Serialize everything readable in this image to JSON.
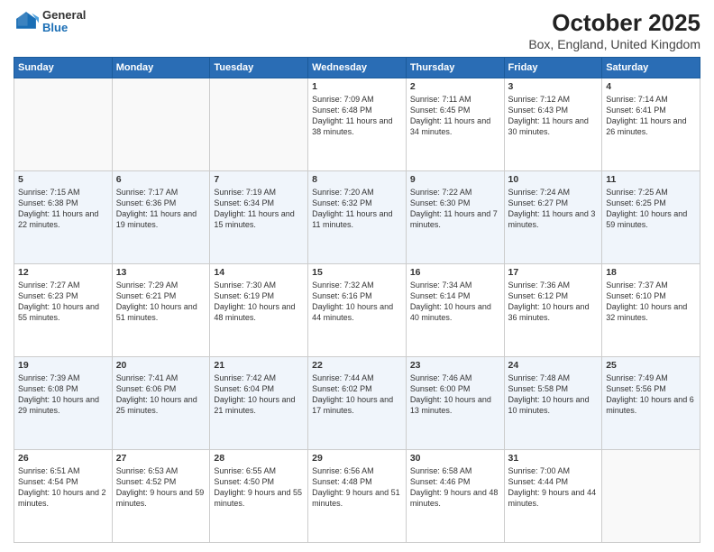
{
  "header": {
    "logo_general": "General",
    "logo_blue": "Blue",
    "title": "October 2025",
    "subtitle": "Box, England, United Kingdom"
  },
  "days_of_week": [
    "Sunday",
    "Monday",
    "Tuesday",
    "Wednesday",
    "Thursday",
    "Friday",
    "Saturday"
  ],
  "weeks": [
    [
      {
        "day": "",
        "info": ""
      },
      {
        "day": "",
        "info": ""
      },
      {
        "day": "",
        "info": ""
      },
      {
        "day": "1",
        "info": "Sunrise: 7:09 AM\nSunset: 6:48 PM\nDaylight: 11 hours\nand 38 minutes."
      },
      {
        "day": "2",
        "info": "Sunrise: 7:11 AM\nSunset: 6:45 PM\nDaylight: 11 hours\nand 34 minutes."
      },
      {
        "day": "3",
        "info": "Sunrise: 7:12 AM\nSunset: 6:43 PM\nDaylight: 11 hours\nand 30 minutes."
      },
      {
        "day": "4",
        "info": "Sunrise: 7:14 AM\nSunset: 6:41 PM\nDaylight: 11 hours\nand 26 minutes."
      }
    ],
    [
      {
        "day": "5",
        "info": "Sunrise: 7:15 AM\nSunset: 6:38 PM\nDaylight: 11 hours\nand 22 minutes."
      },
      {
        "day": "6",
        "info": "Sunrise: 7:17 AM\nSunset: 6:36 PM\nDaylight: 11 hours\nand 19 minutes."
      },
      {
        "day": "7",
        "info": "Sunrise: 7:19 AM\nSunset: 6:34 PM\nDaylight: 11 hours\nand 15 minutes."
      },
      {
        "day": "8",
        "info": "Sunrise: 7:20 AM\nSunset: 6:32 PM\nDaylight: 11 hours\nand 11 minutes."
      },
      {
        "day": "9",
        "info": "Sunrise: 7:22 AM\nSunset: 6:30 PM\nDaylight: 11 hours\nand 7 minutes."
      },
      {
        "day": "10",
        "info": "Sunrise: 7:24 AM\nSunset: 6:27 PM\nDaylight: 11 hours\nand 3 minutes."
      },
      {
        "day": "11",
        "info": "Sunrise: 7:25 AM\nSunset: 6:25 PM\nDaylight: 10 hours\nand 59 minutes."
      }
    ],
    [
      {
        "day": "12",
        "info": "Sunrise: 7:27 AM\nSunset: 6:23 PM\nDaylight: 10 hours\nand 55 minutes."
      },
      {
        "day": "13",
        "info": "Sunrise: 7:29 AM\nSunset: 6:21 PM\nDaylight: 10 hours\nand 51 minutes."
      },
      {
        "day": "14",
        "info": "Sunrise: 7:30 AM\nSunset: 6:19 PM\nDaylight: 10 hours\nand 48 minutes."
      },
      {
        "day": "15",
        "info": "Sunrise: 7:32 AM\nSunset: 6:16 PM\nDaylight: 10 hours\nand 44 minutes."
      },
      {
        "day": "16",
        "info": "Sunrise: 7:34 AM\nSunset: 6:14 PM\nDaylight: 10 hours\nand 40 minutes."
      },
      {
        "day": "17",
        "info": "Sunrise: 7:36 AM\nSunset: 6:12 PM\nDaylight: 10 hours\nand 36 minutes."
      },
      {
        "day": "18",
        "info": "Sunrise: 7:37 AM\nSunset: 6:10 PM\nDaylight: 10 hours\nand 32 minutes."
      }
    ],
    [
      {
        "day": "19",
        "info": "Sunrise: 7:39 AM\nSunset: 6:08 PM\nDaylight: 10 hours\nand 29 minutes."
      },
      {
        "day": "20",
        "info": "Sunrise: 7:41 AM\nSunset: 6:06 PM\nDaylight: 10 hours\nand 25 minutes."
      },
      {
        "day": "21",
        "info": "Sunrise: 7:42 AM\nSunset: 6:04 PM\nDaylight: 10 hours\nand 21 minutes."
      },
      {
        "day": "22",
        "info": "Sunrise: 7:44 AM\nSunset: 6:02 PM\nDaylight: 10 hours\nand 17 minutes."
      },
      {
        "day": "23",
        "info": "Sunrise: 7:46 AM\nSunset: 6:00 PM\nDaylight: 10 hours\nand 13 minutes."
      },
      {
        "day": "24",
        "info": "Sunrise: 7:48 AM\nSunset: 5:58 PM\nDaylight: 10 hours\nand 10 minutes."
      },
      {
        "day": "25",
        "info": "Sunrise: 7:49 AM\nSunset: 5:56 PM\nDaylight: 10 hours\nand 6 minutes."
      }
    ],
    [
      {
        "day": "26",
        "info": "Sunrise: 6:51 AM\nSunset: 4:54 PM\nDaylight: 10 hours\nand 2 minutes."
      },
      {
        "day": "27",
        "info": "Sunrise: 6:53 AM\nSunset: 4:52 PM\nDaylight: 9 hours\nand 59 minutes."
      },
      {
        "day": "28",
        "info": "Sunrise: 6:55 AM\nSunset: 4:50 PM\nDaylight: 9 hours\nand 55 minutes."
      },
      {
        "day": "29",
        "info": "Sunrise: 6:56 AM\nSunset: 4:48 PM\nDaylight: 9 hours\nand 51 minutes."
      },
      {
        "day": "30",
        "info": "Sunrise: 6:58 AM\nSunset: 4:46 PM\nDaylight: 9 hours\nand 48 minutes."
      },
      {
        "day": "31",
        "info": "Sunrise: 7:00 AM\nSunset: 4:44 PM\nDaylight: 9 hours\nand 44 minutes."
      },
      {
        "day": "",
        "info": ""
      }
    ]
  ]
}
